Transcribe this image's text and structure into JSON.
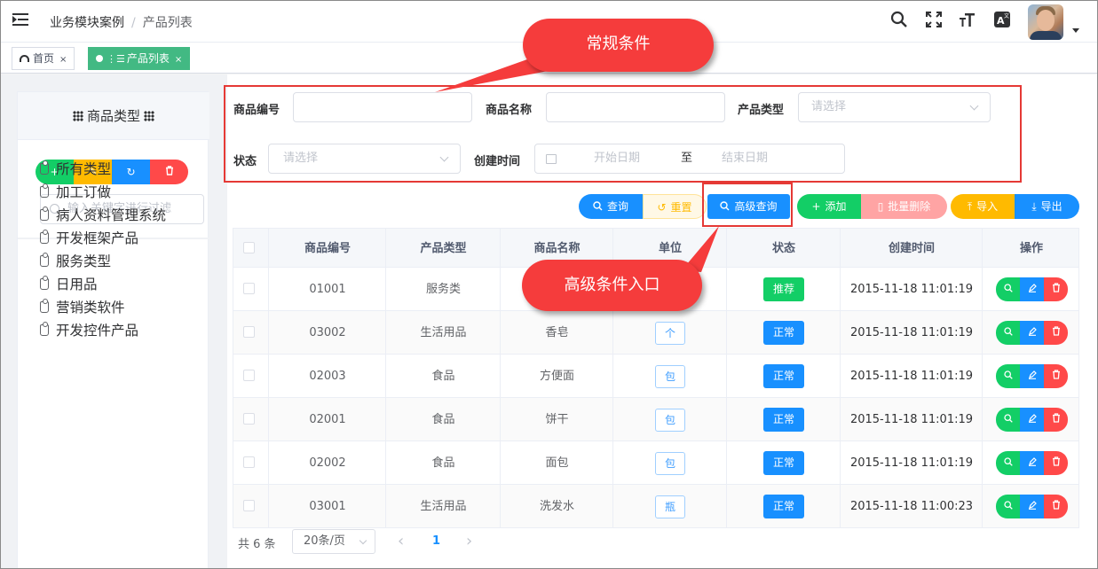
{
  "navbar": {
    "breadcrumb": [
      "业务模块案例",
      "产品列表"
    ],
    "separator": "/",
    "icons": [
      "search-icon",
      "fullscreen-icon",
      "font-size-icon",
      "translate-icon"
    ]
  },
  "tags": [
    {
      "label": "首页",
      "close": "×",
      "active": false
    },
    {
      "label": "产品列表",
      "close": "×",
      "active": true
    }
  ],
  "left": {
    "title": "商品类型",
    "search_placeholder": "输入关键字进行过滤",
    "buttons": [
      "+",
      "✎",
      "↻",
      "🗑"
    ],
    "button_colors": [
      "#13ce66",
      "#ffba00",
      "#1890ff",
      "#ff4949"
    ],
    "tree": [
      "所有类型",
      "加工订做",
      "病人资料管理系统",
      "开发框架产品",
      "服务类型",
      "日用品",
      "营销类软件",
      "开发控件产品"
    ]
  },
  "form": {
    "code_label": "商品编号",
    "name_label": "商品名称",
    "type_label": "产品类型",
    "type_placeholder": "请选择",
    "status_label": "状态",
    "status_placeholder": "请选择",
    "time_label": "创建时间",
    "start_placeholder": "开始日期",
    "range_sep": "至",
    "end_placeholder": "结束日期"
  },
  "toolbar": {
    "query": "查询",
    "reset": "重置",
    "advanced": "高级查询",
    "add": "添加",
    "batch_delete": "批量删除",
    "import": "导入",
    "export": "导出"
  },
  "table": {
    "columns": [
      "商品编号",
      "产品类型",
      "商品名称",
      "单位",
      "状态",
      "创建时间",
      "操作"
    ],
    "rows": [
      {
        "code": "01001",
        "type": "服务类",
        "name": "",
        "unit": "",
        "status": "推荐",
        "time": "2015-11-18 11:01:19"
      },
      {
        "code": "03002",
        "type": "生活用品",
        "name": "香皂",
        "unit": "个",
        "status": "正常",
        "time": "2015-11-18 11:01:19"
      },
      {
        "code": "02003",
        "type": "食品",
        "name": "方便面",
        "unit": "包",
        "status": "正常",
        "time": "2015-11-18 11:01:19"
      },
      {
        "code": "02001",
        "type": "食品",
        "name": "饼干",
        "unit": "包",
        "status": "正常",
        "time": "2015-11-18 11:01:19"
      },
      {
        "code": "02002",
        "type": "食品",
        "name": "面包",
        "unit": "包",
        "status": "正常",
        "time": "2015-11-18 11:01:19"
      },
      {
        "code": "03001",
        "type": "生活用品",
        "name": "洗发水",
        "unit": "瓶",
        "status": "正常",
        "time": "2015-11-18 11:00:23"
      }
    ]
  },
  "pager": {
    "total": "共 6 条",
    "page_size": "20条/页",
    "prev": "‹",
    "current": "1",
    "next": "›"
  },
  "callouts": {
    "normal": "常规条件",
    "advanced": "高级条件入口"
  },
  "colors": {
    "primary": "#1890ff",
    "success": "#13ce66",
    "danger": "#ff4949",
    "warning": "#ffba00",
    "tag_active": "#42b983",
    "callout": "#f53c3c"
  }
}
